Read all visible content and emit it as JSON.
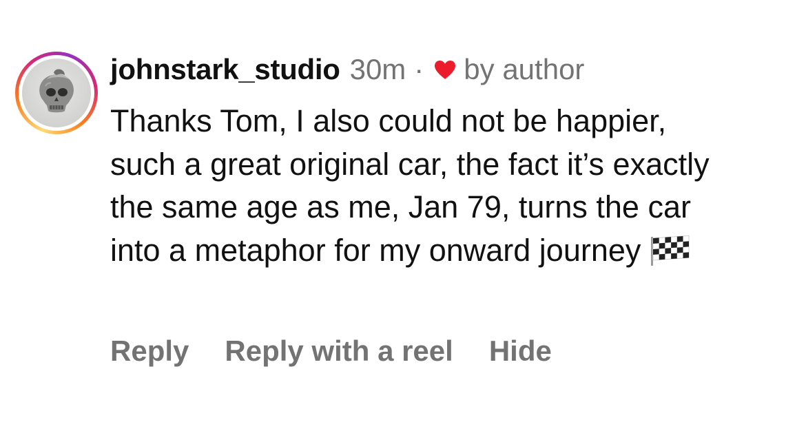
{
  "comment": {
    "avatar_icon": "skull-avatar",
    "username": "johnstark_studio",
    "time": "30m",
    "separator": "·",
    "liked_icon": "heart-icon",
    "liked_color": "#ed1c2c",
    "liked_label": "by author",
    "text": "Thanks Tom, I also could not be happier, such a great original car, the fact it’s exactly the same age as me, Jan 79, turns the car into a metaphor for my onward journey",
    "emoji_icon": "checkered-flag-icon",
    "ring_colors": [
      "#feda75",
      "#fa7e1e",
      "#d62976",
      "#962fbf"
    ],
    "muted_color": "#737373"
  },
  "actions": {
    "reply": "Reply",
    "reply_with_reel": "Reply with a reel",
    "hide": "Hide"
  }
}
